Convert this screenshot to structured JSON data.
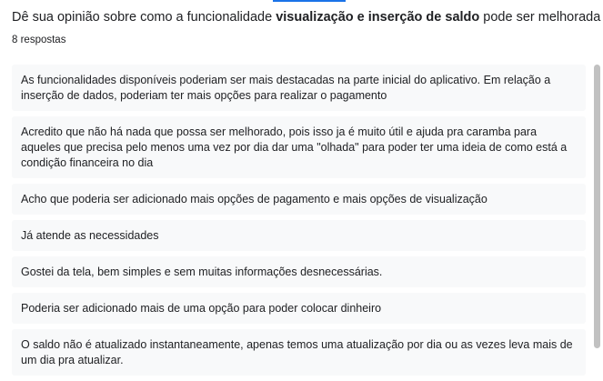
{
  "question": {
    "prefix": "Dê sua opinião sobre como a funcionalidade ",
    "bold": "visualização e inserção de saldo",
    "suffix": " pode ser melhorada"
  },
  "response_count": "8 respostas",
  "responses": [
    "As funcionalidades disponíveis poderiam ser mais destacadas na parte inicial do aplicativo. Em relação a inserção de dados, poderiam ter mais opções para realizar o pagamento",
    "Acredito que não há nada que possa ser melhorado, pois isso ja é muito útil e ajuda pra caramba para aqueles que precisa pelo menos uma vez por dia dar uma \"olhada\" para poder ter uma ideia de como está a condição financeira no dia",
    "Acho que poderia ser adicionado mais opções de pagamento e mais opções de visualização",
    "Já atende as necessidades",
    "Gostei da tela, bem simples e sem muitas informações desnecessárias.",
    "Poderia ser adicionado mais de uma opção para poder colocar dinheiro",
    "O saldo não é atualizado instantaneamente, apenas temos uma atualização por dia ou as vezes leva mais de um dia pra atualizar."
  ],
  "colors": {
    "accent": "#1a73e8",
    "card_bg": "#f8f9fa",
    "text": "#202124",
    "scrollbar": "#c1c1c1"
  }
}
